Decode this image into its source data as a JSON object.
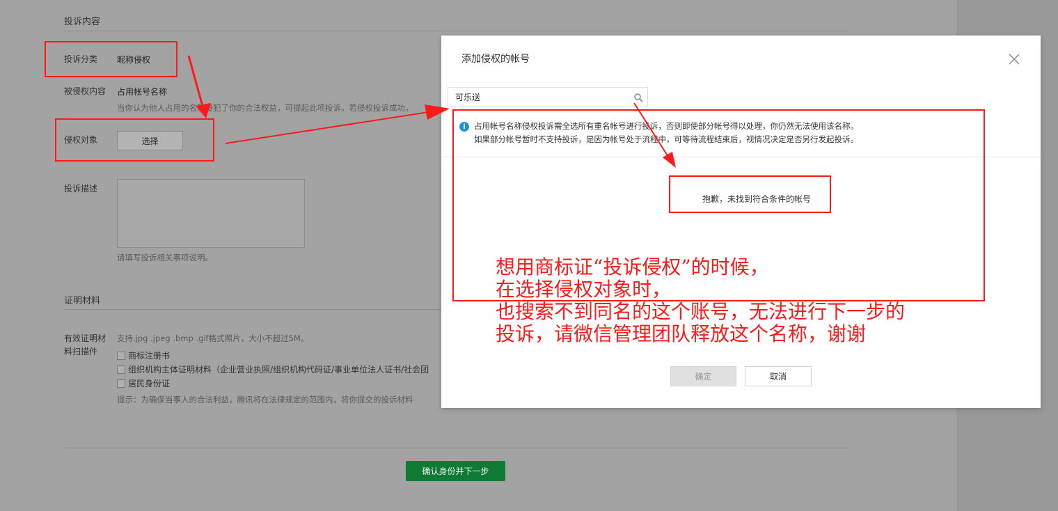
{
  "form": {
    "section_complaint": "投诉内容",
    "category_label": "投诉分类",
    "category_value": "昵称侵权",
    "infringed_label": "被侵权内容",
    "infringed_value": "占用帐号名称",
    "infringed_hint": "当你认为他人占用的名称侵犯了你的合法权益，可提起此项投诉。若侵权投诉成功，",
    "target_label": "侵权对象",
    "select_button": "选择",
    "description_label": "投诉描述",
    "description_hint": "请填写投诉相关事项说明。",
    "section_proof": "证明材料",
    "proof_label_line1": "有效证明材",
    "proof_label_line2": "料扫描件",
    "proof_hint": "支持.jpg .jpeg .bmp .gif格式照片，大小不超过5M。",
    "checkboxes": [
      "商标注册书",
      "组织机构主体证明材料（企业营业执照/组织机构代码证/事业单位法人证书/社会团",
      "居民身份证"
    ],
    "footer_hint": "提示：为确保当事人的合法利益，腾讯将在法律规定的范围内，将你提交的投诉材料",
    "next_button": "确认身份并下一步"
  },
  "modal": {
    "title": "添加侵权的帐号",
    "search_value": "可乐送",
    "notice_line1": "占用帐号名称侵权投诉需全选所有重名帐号进行投诉，否则即使部分帐号得以处理，你仍然无法使用该名称。",
    "notice_line2": "如果部分帐号暂时不支持投诉，是因为帐号处于流程中，可等待流程结束后，视情况决定是否另行发起投诉。",
    "empty_text": "抱歉，未找到符合条件的帐号",
    "ok_button": "确定",
    "cancel_button": "取消"
  },
  "annotation": {
    "lines": [
      "想用商标证“投诉侵权”的时候，",
      "在选择侵权对象时，",
      "也搜索不到同名的这个账号，无法进行下一步的",
      "投诉，请微信管理团队释放这个名称，谢谢"
    ],
    "color": "#ff1a1a"
  },
  "colors": {
    "primary_green": "#0f7a34",
    "info_blue": "#1e90e0"
  }
}
